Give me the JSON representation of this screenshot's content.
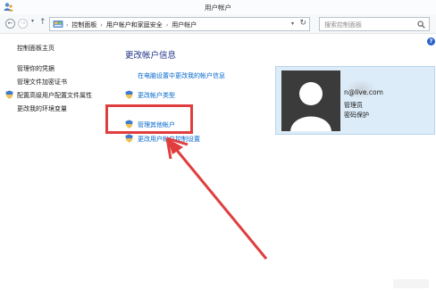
{
  "window": {
    "title": "用户帐户"
  },
  "address_bar": {
    "breadcrumbs": [
      "控制面板",
      "用户帐户和家庭安全",
      "用户帐户"
    ],
    "separator": "›",
    "search_placeholder": "搜索控制面板"
  },
  "sidebar": {
    "items": [
      {
        "label": "控制面板主页",
        "has_shield": false
      },
      {
        "label": "管理你的凭据",
        "has_shield": false
      },
      {
        "label": "管理文件加密证书",
        "has_shield": false
      },
      {
        "label": "配置高级用户配置文件属性",
        "has_shield": true
      },
      {
        "label": "更改我的环境变量",
        "has_shield": false
      }
    ]
  },
  "main": {
    "heading": "更改帐户信息",
    "links": [
      {
        "label": "在电脑设置中更改我的帐户信息",
        "has_shield": false
      },
      {
        "label": "更改帐户类型",
        "has_shield": true
      },
      {
        "label": "管理其他帐户",
        "has_shield": true
      },
      {
        "label": "更改用户帐户控制设置",
        "has_shield": true
      }
    ]
  },
  "account": {
    "email": "n@live.com",
    "role": "管理员",
    "protection": "密码保护"
  },
  "colors": {
    "link": "#0066cc",
    "heading": "#1e3287",
    "card_bg": "#dcecf8",
    "annotation": "#e03e3e"
  },
  "icons": [
    "user-accounts-icon",
    "back-arrow-icon",
    "forward-arrow-icon",
    "up-arrow-icon",
    "control-panel-icon",
    "refresh-icon",
    "search-icon",
    "uac-shield-icon",
    "help-icon",
    "avatar-silhouette-icon"
  ]
}
